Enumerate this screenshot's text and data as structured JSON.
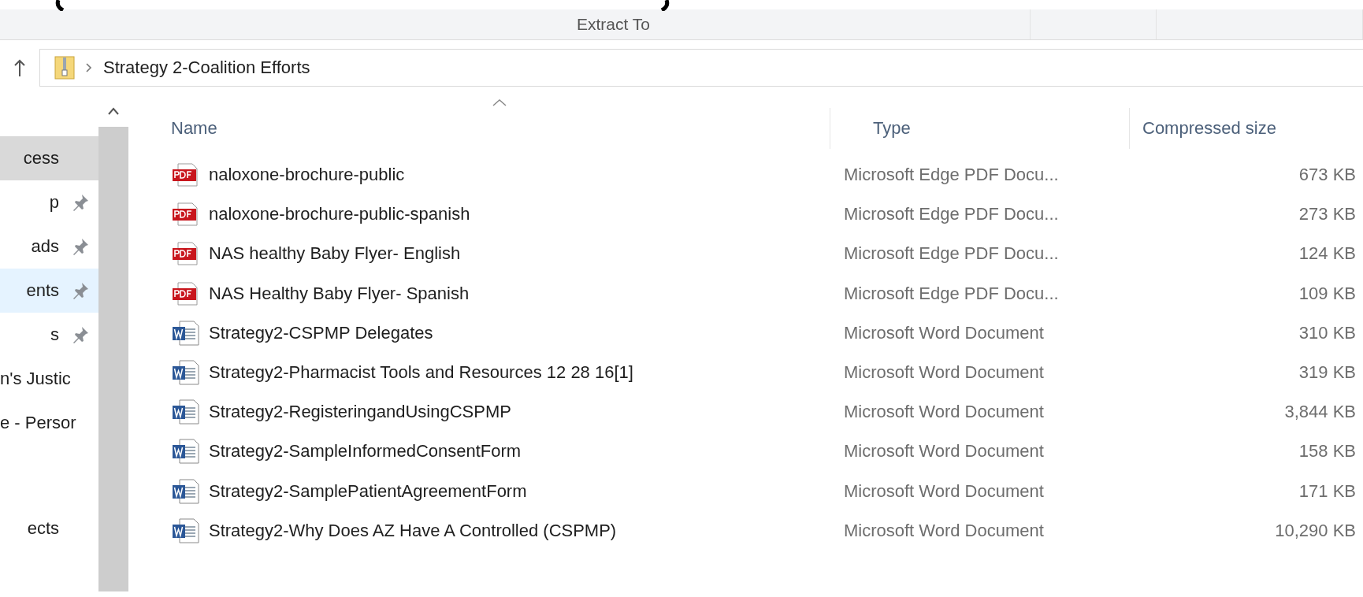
{
  "ribbon": {
    "label": "Extract To"
  },
  "address_bar": {
    "path": "Strategy 2-Coalition Efforts"
  },
  "sidebar": {
    "groups": [
      [
        {
          "label": "cess",
          "pinned": false,
          "selected": true
        },
        {
          "label": "p",
          "pinned": true,
          "selected": false
        },
        {
          "label": "ads",
          "pinned": true,
          "selected": false
        },
        {
          "label": "ents",
          "pinned": true,
          "selected": false,
          "hovered": true
        },
        {
          "label": "s",
          "pinned": true,
          "selected": false
        },
        {
          "label": "n's Justic",
          "pinned": false,
          "selected": false
        },
        {
          "label": "e - Persor",
          "pinned": false,
          "selected": false
        }
      ],
      [
        {
          "label": "ects",
          "pinned": false,
          "selected": false
        }
      ]
    ]
  },
  "table": {
    "columns": [
      {
        "label": "Name",
        "sorted": true
      },
      {
        "label": "Type",
        "sorted": false
      },
      {
        "label": "Compressed size",
        "sorted": false
      }
    ],
    "rows": [
      {
        "kind": "pdf",
        "name": "naloxone-brochure-public",
        "type": "Microsoft Edge PDF Docu...",
        "size": "673 KB"
      },
      {
        "kind": "pdf",
        "name": "naloxone-brochure-public-spanish",
        "type": "Microsoft Edge PDF Docu...",
        "size": "273 KB"
      },
      {
        "kind": "pdf",
        "name": "NAS healthy Baby Flyer- English",
        "type": "Microsoft Edge PDF Docu...",
        "size": "124 KB"
      },
      {
        "kind": "pdf",
        "name": "NAS Healthy Baby Flyer- Spanish",
        "type": "Microsoft Edge PDF Docu...",
        "size": "109 KB"
      },
      {
        "kind": "word",
        "name": "Strategy2-CSPMP Delegates",
        "type": "Microsoft Word Document",
        "size": "310 KB"
      },
      {
        "kind": "word",
        "name": "Strategy2-Pharmacist Tools and Resources 12 28 16[1]",
        "type": "Microsoft Word Document",
        "size": "319 KB"
      },
      {
        "kind": "word",
        "name": "Strategy2-RegisteringandUsingCSPMP",
        "type": "Microsoft Word Document",
        "size": "3,844 KB"
      },
      {
        "kind": "word",
        "name": "Strategy2-SampleInformedConsentForm",
        "type": "Microsoft Word Document",
        "size": "158 KB"
      },
      {
        "kind": "word",
        "name": "Strategy2-SamplePatientAgreementForm",
        "type": "Microsoft Word Document",
        "size": "171 KB"
      },
      {
        "kind": "word",
        "name": "Strategy2-Why Does AZ Have A Controlled (CSPMP)",
        "type": "Microsoft Word Document",
        "size": "10,290 KB"
      }
    ]
  }
}
